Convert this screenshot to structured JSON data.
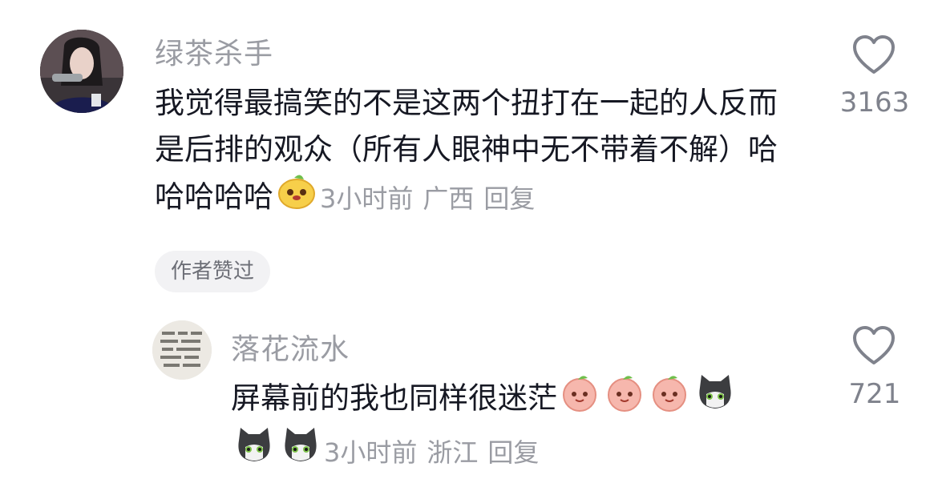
{
  "comment": {
    "username": "绿茶杀手",
    "text": "我觉得最搞笑的不是这两个扭打在一起的人反而是后排的观众（所有人眼神中无不带着不解）哈哈哈哈哈",
    "time": "3小时前",
    "location": "广西",
    "reply_label": "回复",
    "author_liked_label": "作者赞过",
    "like_count": "3163",
    "emoji": "smiling-yellow-face-emoji"
  },
  "reply": {
    "username": "落花流水",
    "text": "屏幕前的我也同样很迷茫",
    "time": "3小时前",
    "location": "浙江",
    "reply_label": "回复",
    "like_count": "721",
    "emojis": [
      "peach-face-emoji",
      "peach-face-emoji",
      "peach-face-emoji",
      "cat-face-emoji",
      "cat-face-emoji",
      "cat-face-emoji"
    ]
  },
  "icons": {
    "like": "heart-outline-icon"
  },
  "colors": {
    "text": "#161823",
    "secondary": "#9a9ca3",
    "chip_bg": "#f2f2f4"
  }
}
